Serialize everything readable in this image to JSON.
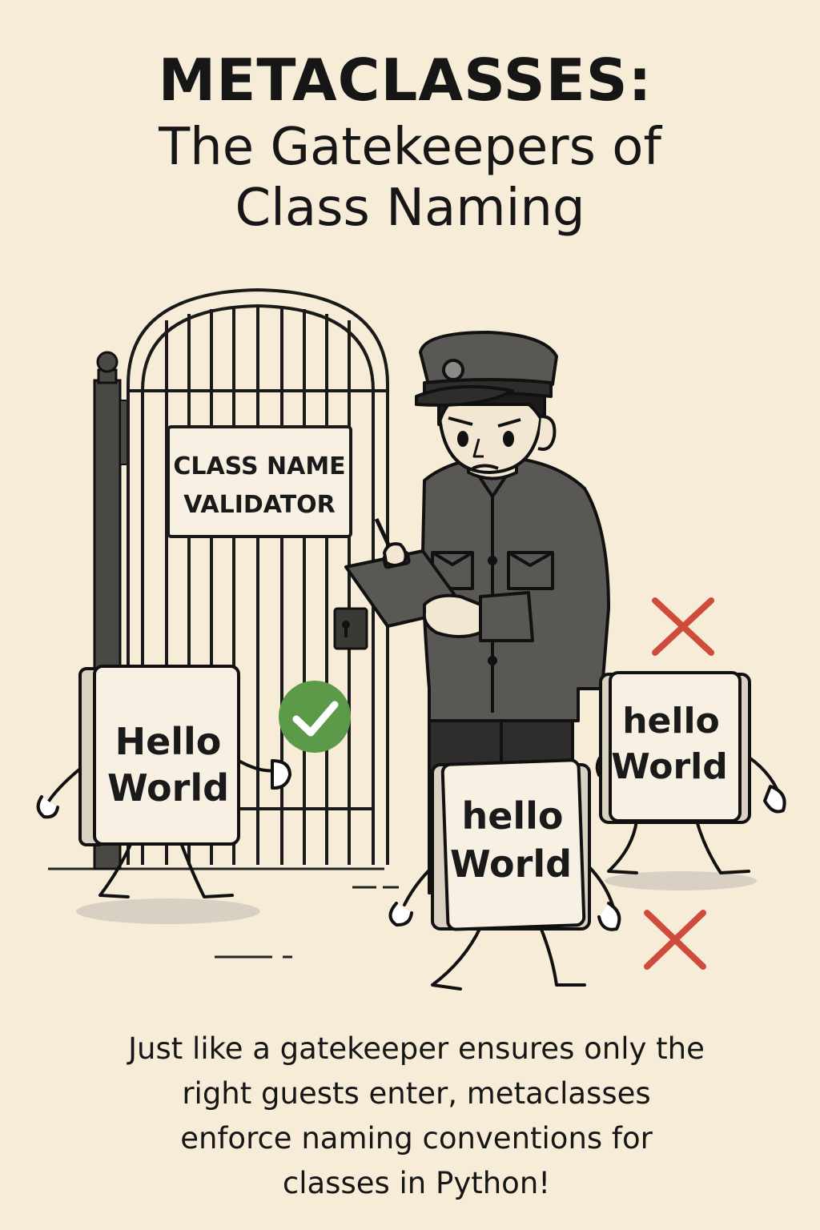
{
  "title": {
    "main": "METACLASSES:",
    "sub_line1": "The Gatekeepers of",
    "sub_line2": "Class Naming"
  },
  "gate_sign": {
    "line1": "CLASS NAME",
    "line2": "VALIDATOR"
  },
  "cards": {
    "accepted": {
      "line1": "Hello",
      "line2": "World",
      "status_icon": "check-icon"
    },
    "rejected_front": {
      "line1": "hello",
      "line2": "World",
      "status_icon": "cross-icon"
    },
    "rejected_back": {
      "line1": "hello",
      "line2": "World",
      "status_icon": "cross-icon"
    }
  },
  "caption": {
    "line1": "Just like a gatekeeper ensures only the",
    "line2": "right guests enter, metaclasses",
    "line3": "enforce naming conventions for",
    "line4": "classes in Python!"
  },
  "colors": {
    "background": "#f6ecd8",
    "check": "#5c9a4a",
    "cross": "#cf4b3c",
    "uniform": "#5a5855"
  }
}
